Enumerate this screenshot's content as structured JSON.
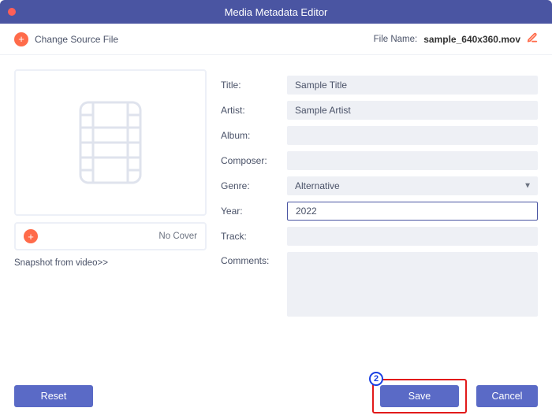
{
  "window": {
    "title": "Media Metadata Editor"
  },
  "topbar": {
    "change_source_label": "Change Source File",
    "filename_label": "File Name:",
    "filename_value": "sample_640x360.mov"
  },
  "cover": {
    "no_cover_label": "No Cover",
    "snapshot_link": "Snapshot from video>>"
  },
  "fields": {
    "title_label": "Title:",
    "title_value": "Sample Title",
    "artist_label": "Artist:",
    "artist_value": "Sample Artist",
    "album_label": "Album:",
    "album_value": "",
    "composer_label": "Composer:",
    "composer_value": "",
    "genre_label": "Genre:",
    "genre_value": "Alternative",
    "year_label": "Year:",
    "year_value": "2022",
    "track_label": "Track:",
    "track_value": "",
    "comments_label": "Comments:",
    "comments_value": ""
  },
  "footer": {
    "reset_label": "Reset",
    "save_label": "Save",
    "cancel_label": "Cancel"
  },
  "annotation": {
    "badge": "2"
  }
}
